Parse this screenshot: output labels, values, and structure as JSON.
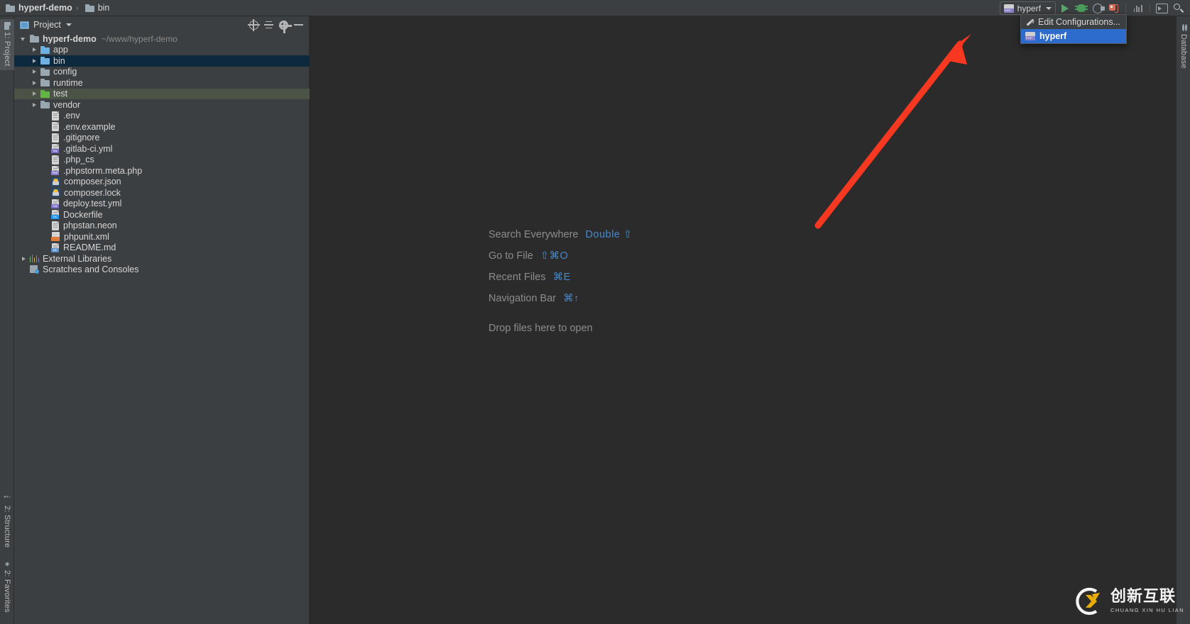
{
  "navbar": {
    "breadcrumbs": [
      {
        "label": "hyperf-demo",
        "icon": "folder-icon",
        "bold": true
      },
      {
        "label": "bin",
        "icon": "folder-icon",
        "bold": false
      }
    ],
    "separator": "›"
  },
  "toolbar": {
    "run_config": {
      "name": "hyperf",
      "icon": "php-run-config-icon"
    },
    "buttons": [
      {
        "name": "run-button",
        "icon": "run-icon"
      },
      {
        "name": "debug-button",
        "icon": "bug-icon"
      },
      {
        "name": "profile-button",
        "icon": "profiler-icon"
      },
      {
        "name": "attach-debugger-button",
        "icon": "attach-debugger-icon"
      },
      {
        "name": "coverage-button",
        "icon": "coverage-bars-icon"
      },
      {
        "name": "terminal-button",
        "icon": "terminal-icon"
      },
      {
        "name": "search-everywhere-button",
        "icon": "search-icon"
      }
    ]
  },
  "run_config_popup": {
    "items": [
      {
        "label": "Edit Configurations...",
        "icon": "pencil-icon",
        "selected": false
      },
      {
        "label": "hyperf",
        "icon": "php-run-config-icon",
        "selected": true
      }
    ]
  },
  "left_strip": {
    "tabs": [
      {
        "label": "1: Project",
        "icon": "folder-icon",
        "active": true
      },
      {
        "label": "2: Structure",
        "icon": "structure-icon",
        "active": false
      },
      {
        "label": "2: Favorites",
        "icon": "favorites-icon",
        "active": false
      }
    ]
  },
  "right_strip": {
    "tabs": [
      {
        "label": "Database",
        "icon": "database-icon",
        "active": false
      }
    ]
  },
  "project_panel": {
    "title": "Project",
    "header_icons": [
      {
        "name": "select-opened-file-icon"
      },
      {
        "name": "collapse-all-icon"
      },
      {
        "name": "settings-gear-icon"
      },
      {
        "name": "hide-panel-icon"
      }
    ],
    "tree": [
      {
        "label": "hyperf-demo",
        "sub": "~/www/hyperf-demo",
        "indent": 0,
        "arrow": "open",
        "icon": "folder-icon",
        "bold": true,
        "selected": ""
      },
      {
        "label": "app",
        "indent": 1,
        "arrow": "closed",
        "icon": "folder-blue-icon",
        "selected": ""
      },
      {
        "label": "bin",
        "indent": 1,
        "arrow": "closed",
        "icon": "folder-blue-icon",
        "selected": "blue"
      },
      {
        "label": "config",
        "indent": 1,
        "arrow": "closed",
        "icon": "folder-icon",
        "selected": ""
      },
      {
        "label": "runtime",
        "indent": 1,
        "arrow": "closed",
        "icon": "folder-icon",
        "selected": ""
      },
      {
        "label": "test",
        "indent": 1,
        "arrow": "closed",
        "icon": "folder-green-icon",
        "selected": "green"
      },
      {
        "label": "vendor",
        "indent": 1,
        "arrow": "closed",
        "icon": "folder-icon",
        "selected": ""
      },
      {
        "label": ".env",
        "indent": 2,
        "arrow": "none",
        "icon": "file-icon",
        "selected": ""
      },
      {
        "label": ".env.example",
        "indent": 2,
        "arrow": "none",
        "icon": "file-icon",
        "selected": ""
      },
      {
        "label": ".gitignore",
        "indent": 2,
        "arrow": "none",
        "icon": "file-icon",
        "selected": ""
      },
      {
        "label": ".gitlab-ci.yml",
        "indent": 2,
        "arrow": "none",
        "icon": "yaml-file-icon",
        "selected": ""
      },
      {
        "label": ".php_cs",
        "indent": 2,
        "arrow": "none",
        "icon": "file-icon",
        "selected": ""
      },
      {
        "label": ".phpstorm.meta.php",
        "indent": 2,
        "arrow": "none",
        "icon": "php-file-icon",
        "selected": ""
      },
      {
        "label": "composer.json",
        "indent": 2,
        "arrow": "none",
        "icon": "composer-file-icon",
        "selected": ""
      },
      {
        "label": "composer.lock",
        "indent": 2,
        "arrow": "none",
        "icon": "composer-file-icon",
        "selected": ""
      },
      {
        "label": "deploy.test.yml",
        "indent": 2,
        "arrow": "none",
        "icon": "yaml-file-icon",
        "selected": ""
      },
      {
        "label": "Dockerfile",
        "indent": 2,
        "arrow": "none",
        "icon": "docker-file-icon",
        "selected": ""
      },
      {
        "label": "phpstan.neon",
        "indent": 2,
        "arrow": "none",
        "icon": "file-icon",
        "selected": ""
      },
      {
        "label": "phpunit.xml",
        "indent": 2,
        "arrow": "none",
        "icon": "xml-file-icon",
        "selected": ""
      },
      {
        "label": "README.md",
        "indent": 2,
        "arrow": "none",
        "icon": "markdown-file-icon",
        "selected": ""
      },
      {
        "label": "External Libraries",
        "indent": 0,
        "arrow": "closed",
        "icon": "external-libraries-icon",
        "selected": ""
      },
      {
        "label": "Scratches and Consoles",
        "indent": 0,
        "arrow": "none",
        "icon": "scratches-icon",
        "selected": ""
      }
    ]
  },
  "editor": {
    "hints": [
      {
        "action": "Search Everywhere",
        "shortcut": "Double ⇧"
      },
      {
        "action": "Go to File",
        "shortcut": "⇧⌘O"
      },
      {
        "action": "Recent Files",
        "shortcut": "⌘E"
      },
      {
        "action": "Navigation Bar",
        "shortcut": "⌘↑"
      }
    ],
    "drop_message": "Drop files here to open"
  },
  "annotation": {
    "arrow_color": "#f93822",
    "name": "red-pointer-arrow"
  },
  "watermark": {
    "chinese": "创新互联",
    "pinyin": "CHUANG XIN HU LIAN"
  },
  "colors": {
    "accent_blue": "#2d6ccc",
    "link_blue": "#4a88c7",
    "panel_bg": "#3c3f41",
    "editor_bg": "#2b2b2b",
    "selection_blue": "#0d293e",
    "selection_green": "#4b5246",
    "red_arrow": "#f93822"
  }
}
